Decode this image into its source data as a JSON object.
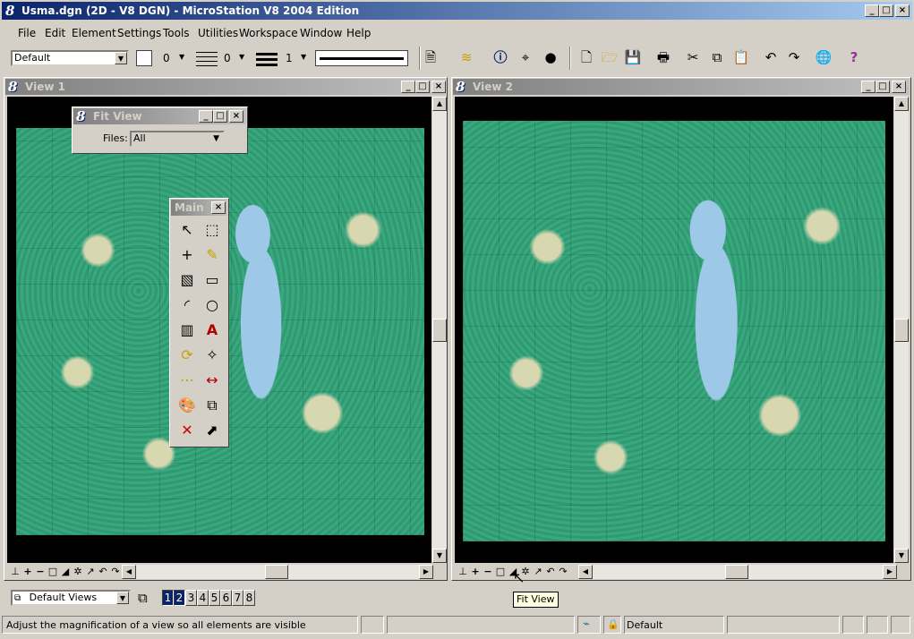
{
  "app": {
    "title": "Usma.dgn (2D - V8 DGN) - MicroStation V8 2004 Edition"
  },
  "menu": [
    {
      "label": "File"
    },
    {
      "label": "Edit"
    },
    {
      "label": "Element"
    },
    {
      "label": "Settings"
    },
    {
      "label": "Tools"
    },
    {
      "label": "Utilities"
    },
    {
      "label": "Workspace"
    },
    {
      "label": "Window"
    },
    {
      "label": "Help"
    }
  ],
  "attributes": {
    "level": "Default",
    "color": "0",
    "style": "0",
    "weight": "1"
  },
  "views": [
    {
      "title": "View 1"
    },
    {
      "title": "View 2"
    }
  ],
  "fit_view": {
    "title": "Fit View",
    "files_label": "Files:",
    "files_value": "All"
  },
  "main_palette": {
    "title": "Main"
  },
  "view_groups": {
    "value": "Default Views",
    "numbers": [
      "1",
      "2",
      "3",
      "4",
      "5",
      "6",
      "7",
      "8"
    ],
    "active": [
      "1",
      "2"
    ]
  },
  "tooltip": "Fit View",
  "status": {
    "prompt": "Adjust the magnification of a view so all elements are visible",
    "active_level": "Default"
  },
  "colors": {
    "title_active": "#0a246a",
    "title_inactive": "#808080",
    "map_green": "#35a078",
    "lake_blue": "#9ec8e8",
    "help_icon": "#9b2c9b"
  }
}
